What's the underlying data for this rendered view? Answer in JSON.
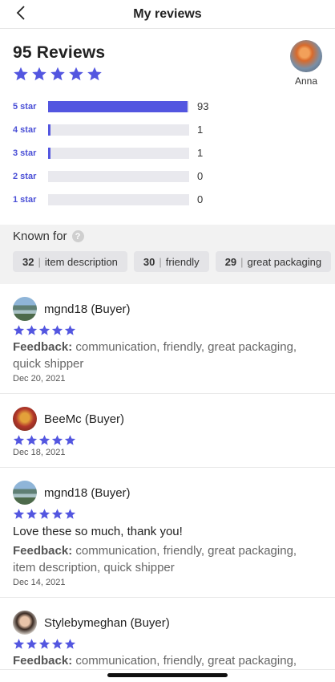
{
  "header": {
    "title": "My reviews"
  },
  "summary": {
    "count_text": "95 Reviews",
    "rating": 5,
    "user_name": "Anna"
  },
  "breakdown": [
    {
      "label": "5 star",
      "count": "93",
      "fraction": 0.989
    },
    {
      "label": "4 star",
      "count": "1",
      "fraction": 0.0106
    },
    {
      "label": "3 star",
      "count": "1",
      "fraction": 0.0106
    },
    {
      "label": "2 star",
      "count": "0",
      "fraction": 0
    },
    {
      "label": "1 star",
      "count": "0",
      "fraction": 0
    }
  ],
  "known_for": {
    "title": "Known for",
    "chips": [
      {
        "count": "32",
        "label": "item description"
      },
      {
        "count": "30",
        "label": "friendly"
      },
      {
        "count": "29",
        "label": "great packaging"
      }
    ]
  },
  "reviews": [
    {
      "avatar": "mountain",
      "name": "mgnd18 (Buyer)",
      "stars": 5,
      "text": "",
      "feedback_label": "Feedback:",
      "feedback": "communication, friendly, great packaging, quick shipper",
      "date": "Dec 20, 2021"
    },
    {
      "avatar": "bee",
      "name": "BeeMc (Buyer)",
      "stars": 5,
      "text": "",
      "feedback_label": "",
      "feedback": "",
      "date": "Dec 18, 2021"
    },
    {
      "avatar": "mountain",
      "name": "mgnd18 (Buyer)",
      "stars": 5,
      "text": "Love these so much, thank you!",
      "feedback_label": "Feedback:",
      "feedback": "communication, friendly, great packaging, item description, quick shipper",
      "date": "Dec 14, 2021"
    },
    {
      "avatar": "meghan",
      "name": "Stylebymeghan (Buyer)",
      "stars": 5,
      "text": "",
      "feedback_label": "Feedback:",
      "feedback": "communication, friendly, great packaging,",
      "date": ""
    }
  ],
  "colors": {
    "star": "#5356e0",
    "bar": "#5356e0",
    "label": "#4a4fd6"
  },
  "icons": {
    "back": "chevron-left-icon",
    "help": "question-circle-icon",
    "star": "star-icon"
  }
}
